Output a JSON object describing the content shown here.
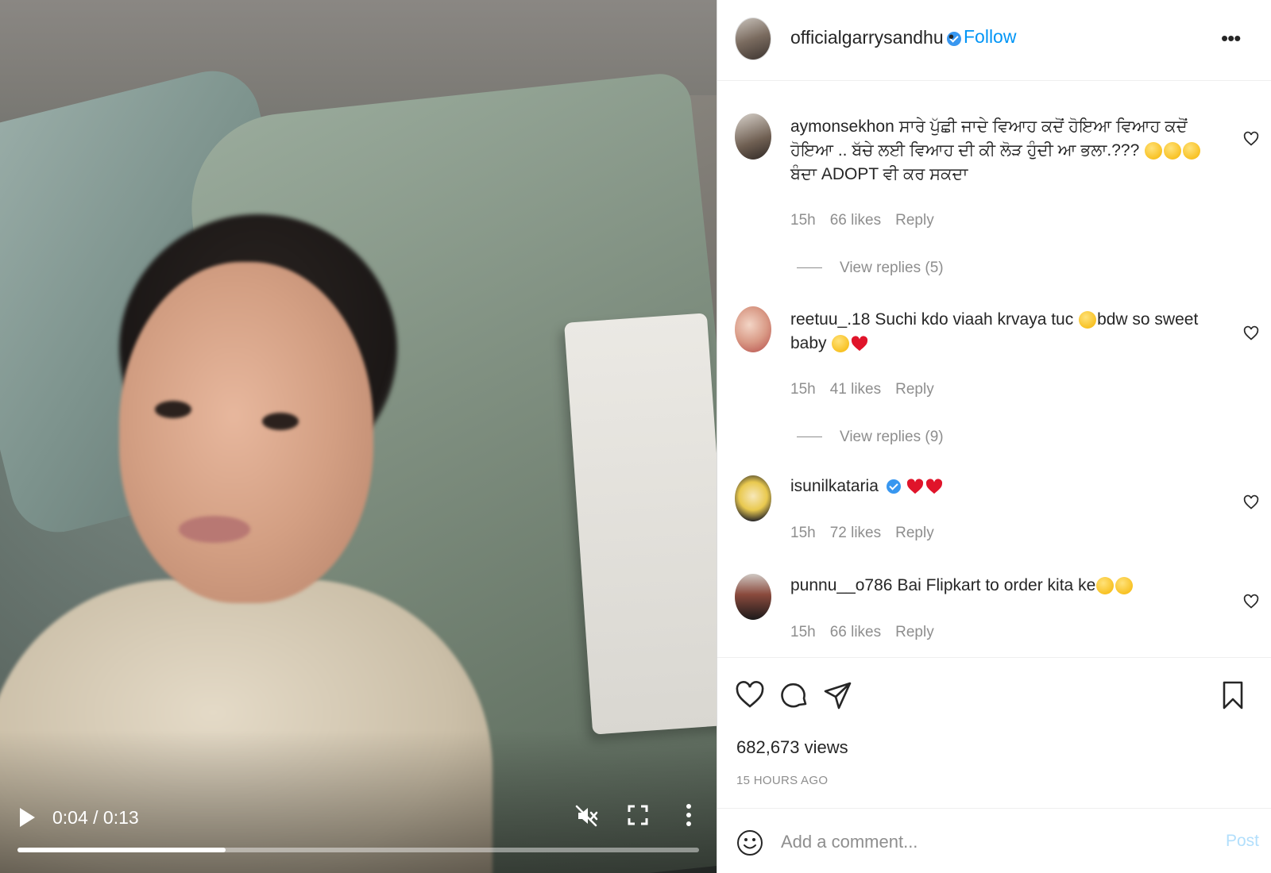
{
  "video": {
    "time": "0:04 / 0:13",
    "progress_fraction": 0.305,
    "muted": true
  },
  "header": {
    "username": "officialgarrysandhu",
    "verified": true,
    "separator": "•",
    "follow_label": "Follow",
    "more_label": "•••"
  },
  "comments": [
    {
      "username": "aymonsekhon",
      "text_parts": [
        "ਸਾਰੇ ਪੁੱਛੀ ਜਾਦੇ ਵਿਆਹ ਕਦੋਂ ਹੋਇਆ ਵਿਆਹ ਕਦੋਂ ਹੋਇਆ .. ਬੱਚੇ ਲਈ ਵਿਆਹ ਦੀ ਕੀ ਲੋੜ ਹੁੰਦੀ ਆ ਭਲਾ.???",
        "ਬੰਦਾ ADOPT ਵੀ ਕਰ ਸਕਦਾ"
      ],
      "time": "15h",
      "likes": "66 likes",
      "reply_label": "Reply",
      "view_replies": "View replies (5)"
    },
    {
      "username": "reetuu_.18",
      "text_parts": [
        "Suchi kdo viaah krvaya tuc",
        "bdw so sweet baby"
      ],
      "time": "15h",
      "likes": "41 likes",
      "reply_label": "Reply",
      "view_replies": "View replies (9)"
    },
    {
      "username": "isunilkataria",
      "verified": true,
      "time": "15h",
      "likes": "72 likes",
      "reply_label": "Reply"
    },
    {
      "username": "punnu__o786",
      "text_parts": [
        "Bai Flipkart to order kita ke"
      ],
      "time": "15h",
      "likes": "66 likes",
      "reply_label": "Reply"
    }
  ],
  "stats": {
    "views": "682,673 views",
    "posted": "15 HOURS AGO"
  },
  "composer": {
    "placeholder": "Add a comment...",
    "post_label": "Post"
  },
  "colors": {
    "link": "#0095f6",
    "muted_text": "#8e8e8e",
    "post_disabled": "#b2dffc",
    "verified": "#3897f0",
    "heart_red": "#e0142a"
  },
  "icons": [
    "play-icon",
    "mute-icon",
    "fullscreen-icon",
    "more-vertical-icon",
    "heart-icon",
    "comment-icon",
    "share-icon",
    "bookmark-icon",
    "smiley-icon"
  ]
}
